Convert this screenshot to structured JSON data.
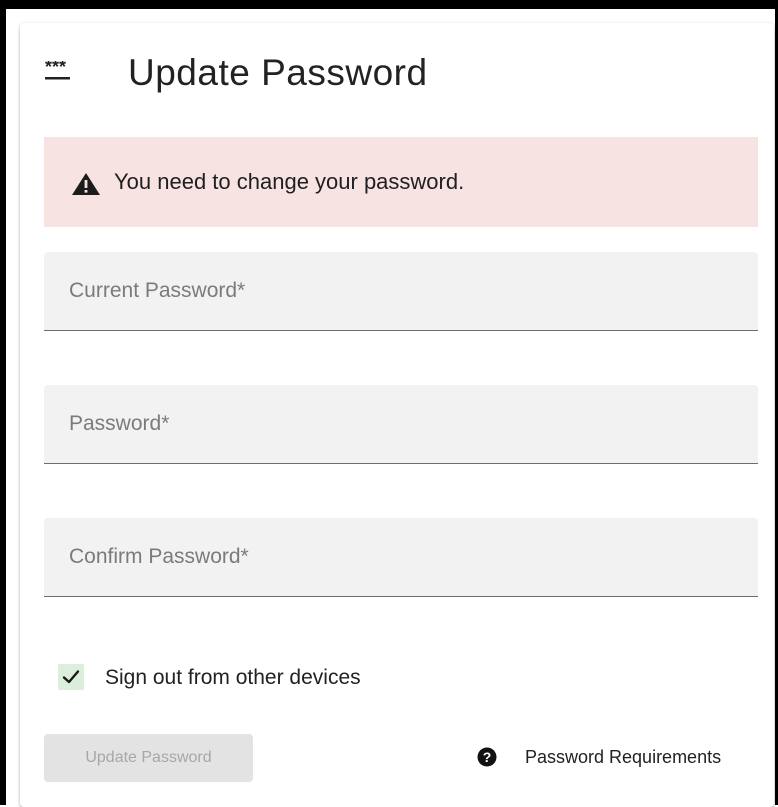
{
  "header": {
    "title": "Update Password",
    "icon": "password-dots-icon"
  },
  "alert": {
    "icon": "warning-triangle-icon",
    "message": "You need to change your password.",
    "background": "#f8e3e3"
  },
  "form": {
    "current_password": {
      "placeholder": "Current Password*",
      "value": ""
    },
    "password": {
      "placeholder": "Password*",
      "value": ""
    },
    "confirm_password": {
      "placeholder": "Confirm Password*",
      "value": ""
    }
  },
  "sign_out_other_devices": {
    "label": "Sign out from other devices",
    "checked": true,
    "icon": "check-icon",
    "accent": "#dcefdc"
  },
  "actions": {
    "update_button_label": "Update Password",
    "update_button_disabled": true,
    "requirements_link_label": "Password Requirements",
    "requirements_icon": "help-circle-icon"
  }
}
